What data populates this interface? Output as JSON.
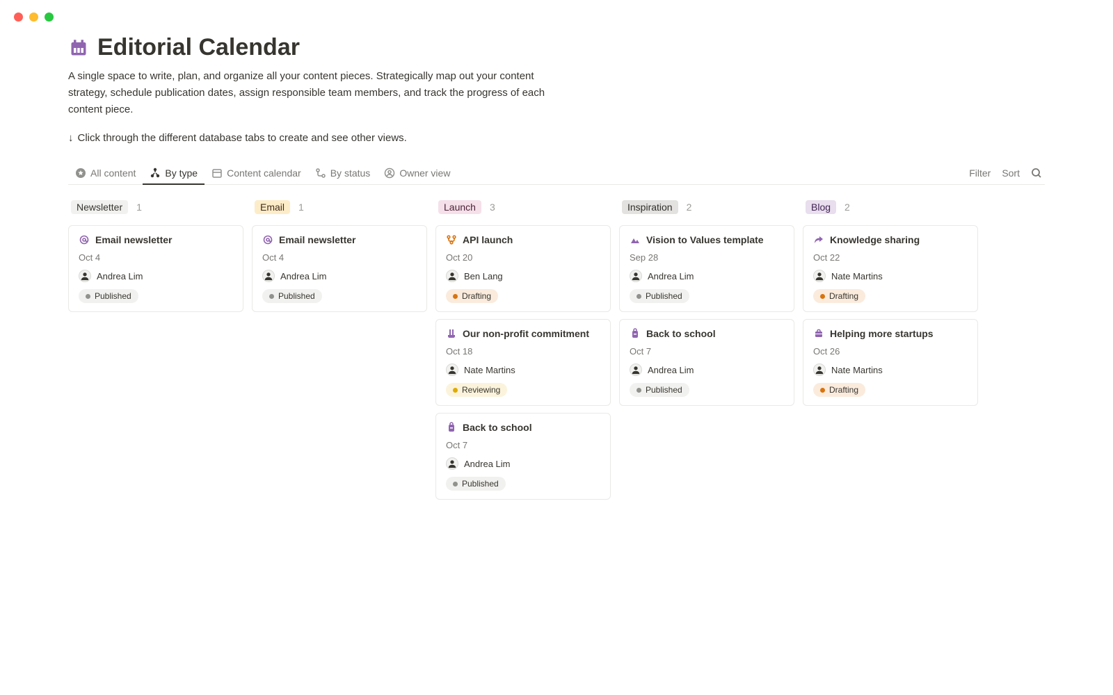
{
  "header": {
    "title": "Editorial Calendar",
    "description": "A single space to write, plan, and organize all your content pieces. Strategically map out your content strategy, schedule publication dates, assign responsible team members, and track the progress of each content piece.",
    "hint": "Click through the different database tabs to create and see other views."
  },
  "views": {
    "tabs": [
      {
        "label": "All content",
        "active": false
      },
      {
        "label": "By type",
        "active": true
      },
      {
        "label": "Content calendar",
        "active": false
      },
      {
        "label": "By status",
        "active": false
      },
      {
        "label": "Owner view",
        "active": false
      }
    ],
    "actions": {
      "filter": "Filter",
      "sort": "Sort"
    }
  },
  "columns": [
    {
      "label": "Newsletter",
      "count": "1",
      "labelClass": "label-default"
    },
    {
      "label": "Email",
      "count": "1",
      "labelClass": "label-yellow"
    },
    {
      "label": "Launch",
      "count": "3",
      "labelClass": "label-pink"
    },
    {
      "label": "Inspiration",
      "count": "2",
      "labelClass": "label-gray"
    },
    {
      "label": "Blog",
      "count": "2",
      "labelClass": "label-purple"
    }
  ],
  "cards": {
    "c0_0": {
      "title": "Email newsletter",
      "date": "Oct 4",
      "owner": "Andrea Lim",
      "status": "Published",
      "statusClass": "pill-gray"
    },
    "c1_0": {
      "title": "Email newsletter",
      "date": "Oct 4",
      "owner": "Andrea Lim",
      "status": "Published",
      "statusClass": "pill-gray"
    },
    "c2_0": {
      "title": "API launch",
      "date": "Oct 20",
      "owner": "Ben Lang",
      "status": "Drafting",
      "statusClass": "pill-orange"
    },
    "c2_1": {
      "title": "Our non-profit commitment",
      "date": "Oct 18",
      "owner": "Nate Martins",
      "status": "Reviewing",
      "statusClass": "pill-yellow"
    },
    "c2_2": {
      "title": "Back to school",
      "date": "Oct 7",
      "owner": "Andrea Lim",
      "status": "Published",
      "statusClass": "pill-gray"
    },
    "c3_0": {
      "title": "Vision to Values template",
      "date": "Sep 28",
      "owner": "Andrea Lim",
      "status": "Published",
      "statusClass": "pill-gray"
    },
    "c3_1": {
      "title": "Back to school",
      "date": "Oct 7",
      "owner": "Andrea Lim",
      "status": "Published",
      "statusClass": "pill-gray"
    },
    "c4_0": {
      "title": "Knowledge sharing",
      "date": "Oct 22",
      "owner": "Nate Martins",
      "status": "Drafting",
      "statusClass": "pill-orange"
    },
    "c4_1": {
      "title": "Helping more startups",
      "date": "Oct 26",
      "owner": "Nate Martins",
      "status": "Drafting",
      "statusClass": "pill-orange"
    }
  }
}
